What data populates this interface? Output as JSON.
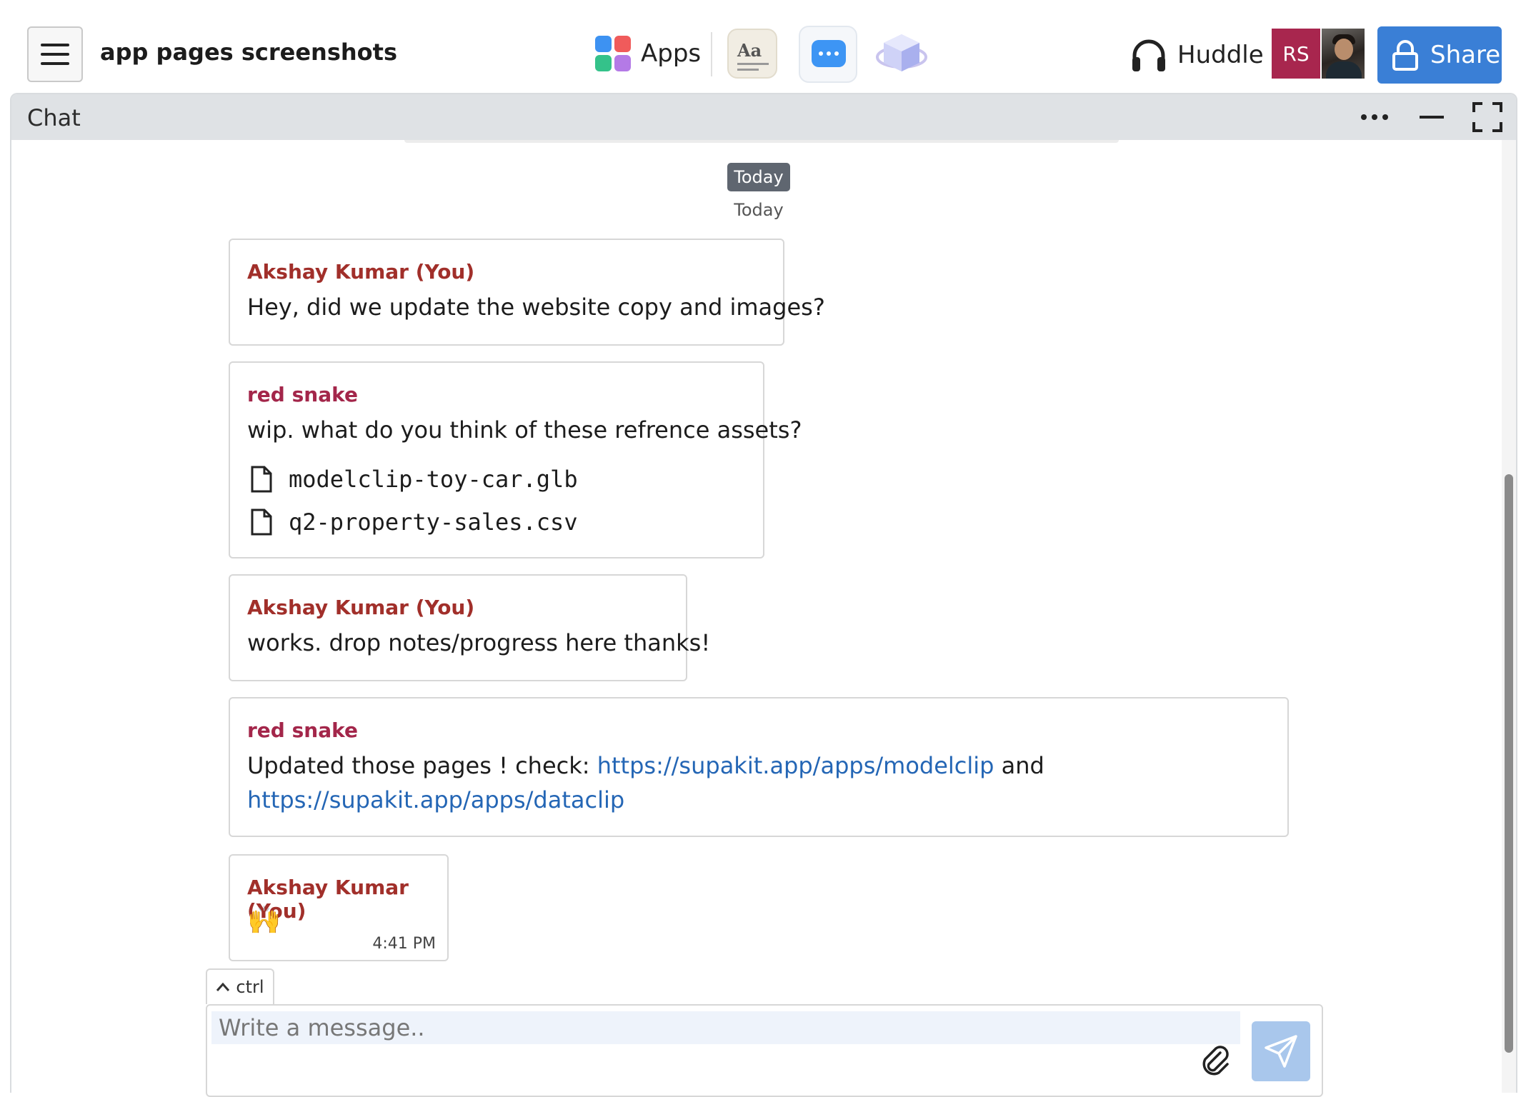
{
  "topbar": {
    "document_title": "app pages screenshots",
    "apps_label": "Apps",
    "huddle_label": "Huddle",
    "avatar_initials": "RS",
    "share_label": "Share",
    "avatar_color": "#a8264e",
    "share_color": "#3a7fd6"
  },
  "chat": {
    "title": "Chat",
    "date_badge": "Today",
    "date_text": "Today",
    "messages": [
      {
        "author": "Akshay Kumar (You)",
        "text": "Hey, did we update the website copy and images?"
      },
      {
        "author": "red snake",
        "text": "wip. what do you think of these refrence assets?",
        "files": [
          "modelclip-toy-car.glb",
          "q2-property-sales.csv"
        ]
      },
      {
        "author": "Akshay Kumar (You)",
        "text": "works. drop notes/progress here thanks!"
      },
      {
        "author": "red snake",
        "text_before": "Updated those pages ! check: ",
        "link1": "https://supakit.app/apps/modelclip",
        "text_middle": " and",
        "link2": "https://supakit.app/apps/dataclip"
      },
      {
        "author": "Akshay Kumar (You)",
        "emoji": "🙌",
        "time": "4:41 PM"
      }
    ],
    "author_colors": {
      "you": "#a12f2a",
      "other": "#a3264a"
    },
    "link_color": "#2466b5"
  },
  "composer": {
    "shortcut_hint": "ctrl",
    "placeholder": "Write a message..",
    "value": ""
  }
}
